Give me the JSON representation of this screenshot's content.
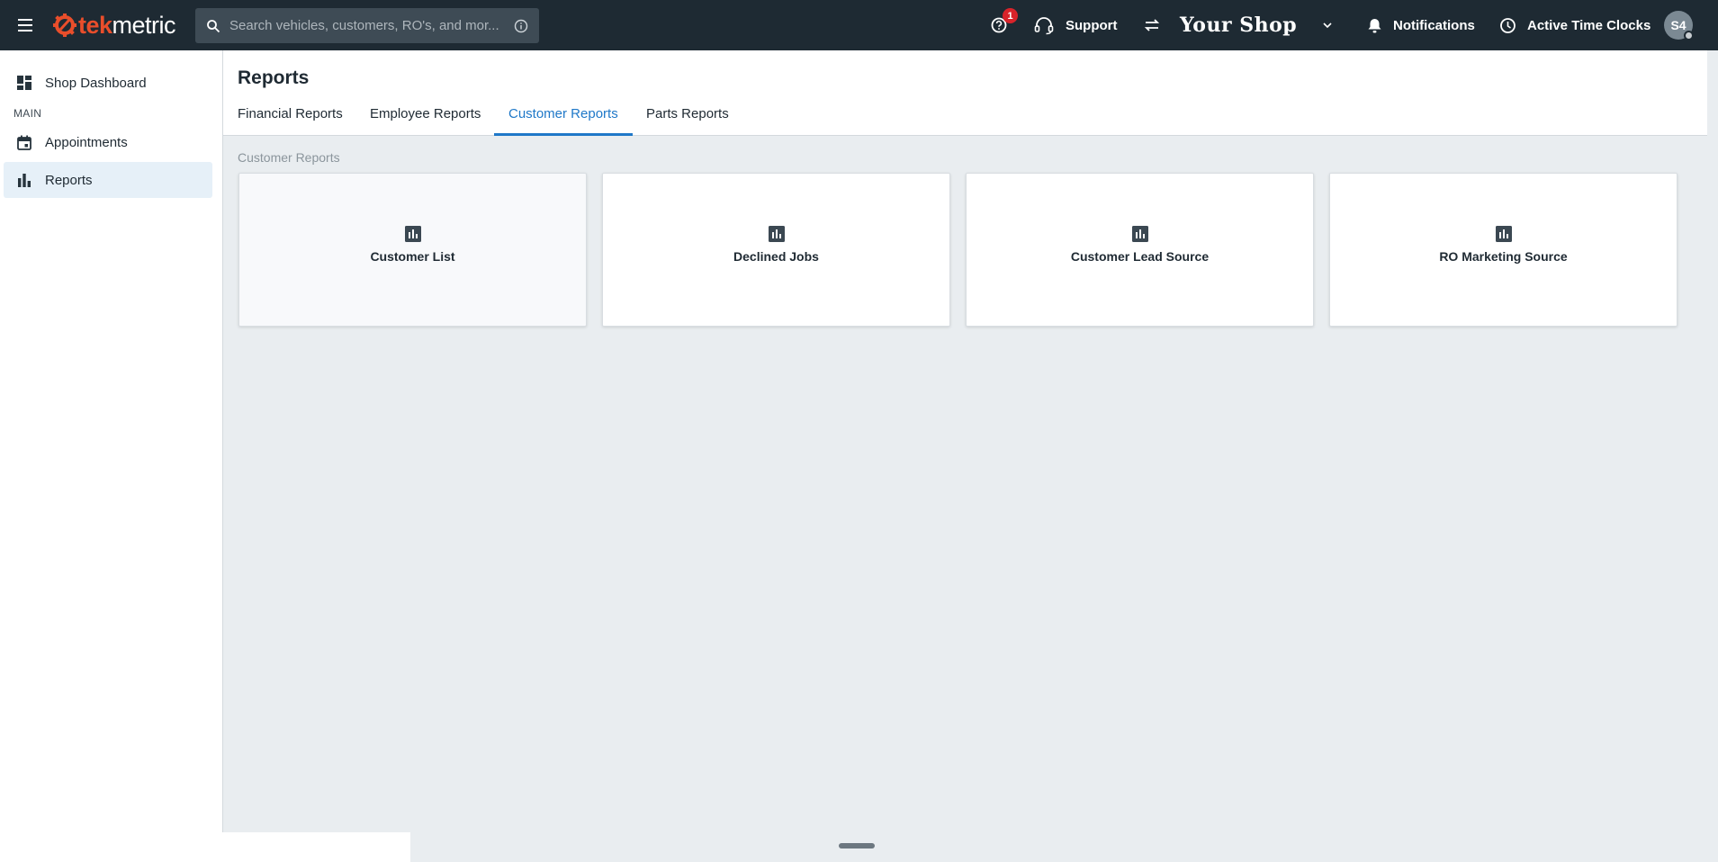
{
  "topbar": {
    "logo_prefix": "tek",
    "logo_suffix": "metric",
    "search_placeholder": "Search vehicles, customers, RO's, and mor...",
    "help_badge": "1",
    "support_label": "Support",
    "shop_name": "Your Shop",
    "notifications_label": "Notifications",
    "time_clocks_label": "Active Time Clocks",
    "avatar_initials": "S4"
  },
  "sidebar": {
    "dashboard_label": "Shop Dashboard",
    "section_main": "MAIN",
    "items": [
      {
        "label": "Appointments",
        "icon": "calendar-icon"
      },
      {
        "label": "Reports",
        "icon": "bar-chart-icon",
        "active": true
      }
    ]
  },
  "main": {
    "title": "Reports",
    "tabs": [
      {
        "label": "Financial Reports"
      },
      {
        "label": "Employee Reports"
      },
      {
        "label": "Customer Reports",
        "active": true
      },
      {
        "label": "Parts Reports"
      }
    ],
    "section_label": "Customer Reports",
    "cards": [
      {
        "label": "Customer List",
        "icon": "report-icon"
      },
      {
        "label": "Declined Jobs",
        "icon": "report-icon"
      },
      {
        "label": "Customer Lead Source",
        "icon": "report-icon"
      },
      {
        "label": "RO Marketing Source",
        "icon": "report-icon"
      }
    ]
  },
  "colors": {
    "topbar_bg": "#1e2a33",
    "accent": "#1f78c8",
    "brand": "#e94e2b",
    "badge": "#d8232a"
  }
}
